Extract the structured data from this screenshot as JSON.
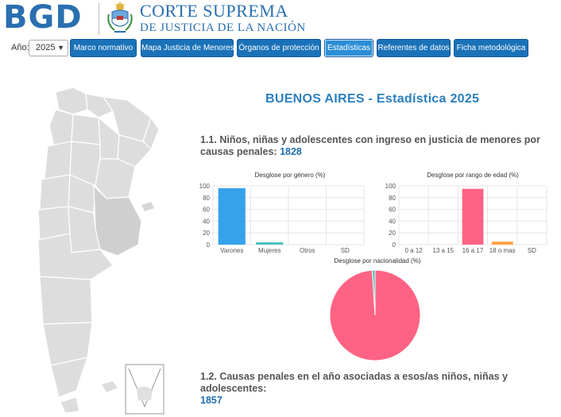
{
  "header": {
    "logo": "BGD",
    "title_line1": "CORTE SUPREMA",
    "title_line2": "DE JUSTICIA DE LA NACIÓN"
  },
  "nav": {
    "year_label": "Año:",
    "year_value": "2025",
    "buttons": [
      {
        "label": "Marco normativo"
      },
      {
        "label": "Mapa Justicia de Menores"
      },
      {
        "label": "Órganos de protección"
      },
      {
        "label": "Estadísticas"
      },
      {
        "label": "Referentes de datos"
      },
      {
        "label": "Ficha metodológica"
      }
    ]
  },
  "page": {
    "title": "BUENOS AIRES - Estadística 2025",
    "section1_text": "1.1. Niños, niñas y adolescentes con ingreso en justicia de menores por causas penales:",
    "section1_value": "1828",
    "section2_text": "1.2. Causas penales en el año asociadas a esos/as niños, niñas y adolescentes:",
    "section2_value": "1857"
  },
  "colors": {
    "primary": "#1a72b8",
    "title_blue": "#2a7fbf",
    "bar_blue": "#36a2eb",
    "bar_teal": "#4bc0c0",
    "bar_pink": "#ff6384",
    "bar_orange": "#ff9f40"
  },
  "chart_data": [
    {
      "type": "bar",
      "title": "Desglose por género (%)",
      "categories": [
        "Varones",
        "Mujeres",
        "Otros",
        "SD"
      ],
      "values": [
        96,
        4,
        0,
        0
      ],
      "colors": [
        "#36a2eb",
        "#4bc0c0",
        "#ff9f40",
        "#9966ff"
      ],
      "ylim": [
        0,
        100
      ],
      "yticks": [
        0,
        20,
        40,
        60,
        80,
        100
      ],
      "grid": true
    },
    {
      "type": "bar",
      "title": "Desglose por rango de edad (%)",
      "categories": [
        "0 a 12",
        "13 a 15",
        "16 a 17",
        "18 o mas",
        "SD"
      ],
      "values": [
        0,
        0,
        95,
        5,
        0
      ],
      "colors": [
        "#36a2eb",
        "#4bc0c0",
        "#ff6384",
        "#ff9f40",
        "#9966ff"
      ],
      "ylim": [
        0,
        100
      ],
      "yticks": [
        0,
        20,
        40,
        60,
        80,
        100
      ],
      "grid": true
    },
    {
      "type": "pie",
      "title": "Desglose por nacionalidad (%)",
      "values": [
        99,
        1
      ],
      "colors": [
        "#ff6384",
        "#4bc0c0"
      ]
    }
  ]
}
